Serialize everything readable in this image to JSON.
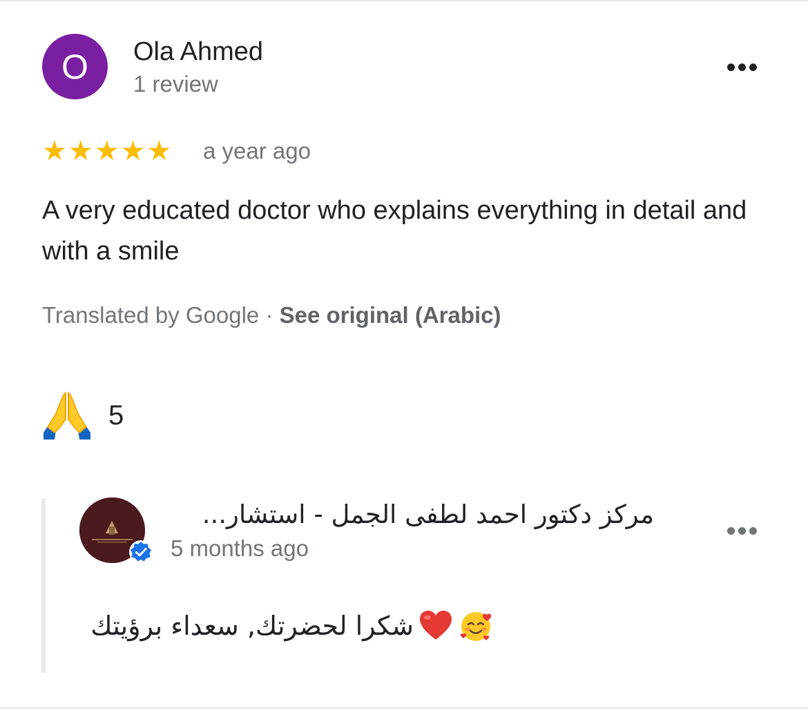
{
  "review": {
    "author_initial": "O",
    "author_name": "Ola Ahmed",
    "author_meta": "1 review",
    "rating": 5,
    "time": "a year ago",
    "text": "A very educated doctor who explains everything in detail and with a smile",
    "translated_prefix": "Translated by Google · ",
    "see_original": "See original (Arabic)",
    "reaction_icon": "folded-hands-emoji",
    "reaction_count": "5"
  },
  "owner_reply": {
    "name": "مركز دكتور احمد لطفى الجمل - استشار...",
    "time": "5 months ago",
    "text": "شكرا لحضرتك, سعداء برؤيتك",
    "emojis": [
      "red-heart-emoji",
      "smiling-face-with-hearts-emoji"
    ],
    "verified_icon": "verified-badge-icon"
  },
  "colors": {
    "avatar_bg": "#7b1fa2",
    "star": "#fbbc04",
    "secondary_text": "#70757a",
    "verified": "#1a73e8"
  }
}
